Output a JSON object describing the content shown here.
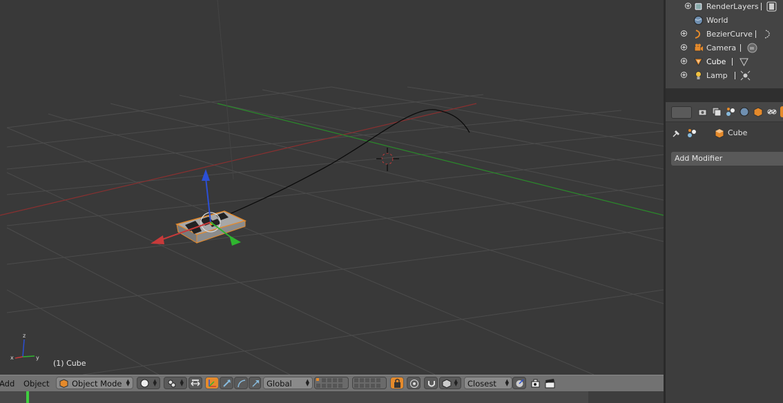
{
  "viewport": {
    "object_label": "(1) Cube",
    "axis_labels": {
      "x": "x",
      "y": "y",
      "z": "z"
    }
  },
  "header": {
    "menu_add": "Add",
    "menu_object": "Object",
    "mode": "Object Mode",
    "orientation": "Global",
    "snap_target": "Closest"
  },
  "outliner": {
    "items": [
      {
        "label": "RenderLayers",
        "icon": "renderlayers-icon"
      },
      {
        "label": "World",
        "icon": "world-icon"
      },
      {
        "label": "BezierCurve",
        "icon": "curve-icon"
      },
      {
        "label": "Camera",
        "icon": "camera-icon"
      },
      {
        "label": "Cube",
        "icon": "mesh-icon"
      },
      {
        "label": "Lamp",
        "icon": "lamp-icon"
      }
    ]
  },
  "properties": {
    "context_object": "Cube",
    "add_modifier": "Add Modifier"
  },
  "colors": {
    "accent": "#e58a2b",
    "x_axis": "#c83a3a",
    "y_axis": "#2fb52f",
    "z_axis": "#2b4fd6",
    "frame_cursor": "#3fcf3f"
  }
}
